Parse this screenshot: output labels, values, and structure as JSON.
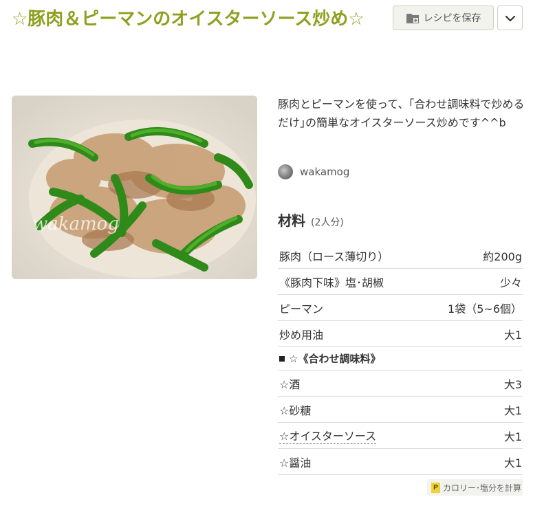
{
  "recipe": {
    "title": "☆豚肉＆ピーマンのオイスターソース炒め☆",
    "description": "豚肉とピーマンを使って、｢合わせ調味料で炒めるだけ｣の簡単なオイスターソース炒めです^^b",
    "author": "wakamog",
    "photo_watermark": "wakamog"
  },
  "actions": {
    "save_label": "レシピを保存",
    "save_icon": "folder-plus-icon",
    "menu_icon": "chevron-down-icon",
    "calc_label": "カロリー･塩分を計算",
    "calc_icon_letter": "P"
  },
  "ingredients": {
    "heading": "材料",
    "servings": "(2人分)",
    "items": [
      {
        "name": "豚肉（ロース薄切り）",
        "amount": "約200g"
      },
      {
        "name": "《豚肉下味》塩･胡椒",
        "amount": "少々"
      },
      {
        "name": "ピーマン",
        "amount": "1袋（5~6個）"
      },
      {
        "name": "炒め用油",
        "amount": "大1"
      }
    ],
    "group_title": "☆《合わせ調味料》",
    "group_items": [
      {
        "name": "☆酒",
        "amount": "大3"
      },
      {
        "name": "☆砂糖",
        "amount": "大1"
      },
      {
        "name": "☆オイスターソース",
        "amount": "大1"
      },
      {
        "name": "☆醤油",
        "amount": "大1"
      }
    ]
  },
  "colors": {
    "title": "#8fa01f",
    "border": "#dcdcdc",
    "button_bg": "#f3f3ee"
  }
}
